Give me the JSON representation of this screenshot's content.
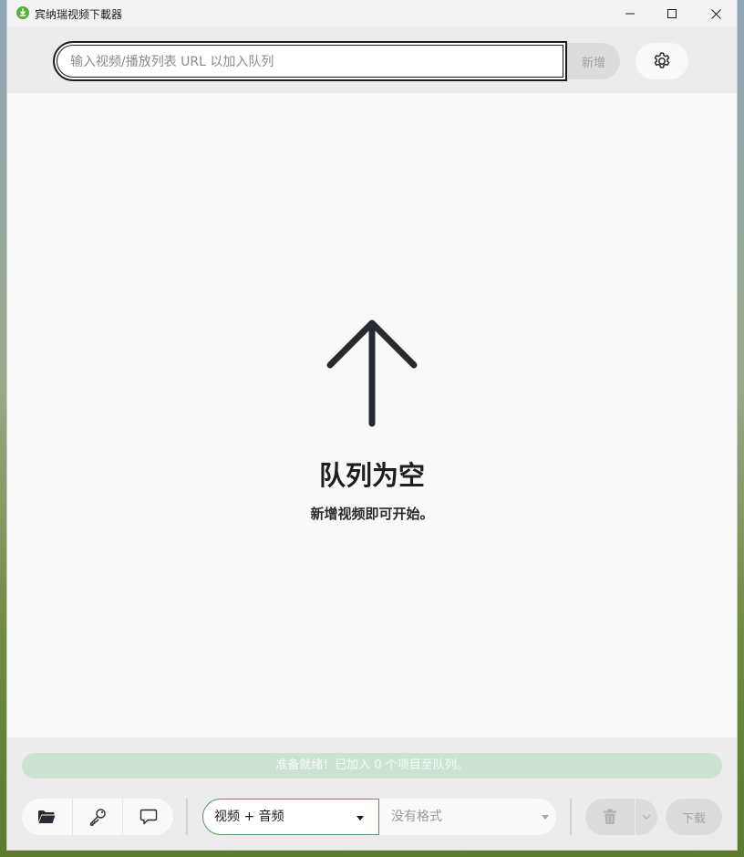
{
  "window": {
    "title": "宾纳瑞视频下載器",
    "controls": {
      "minimize": "minimize-icon",
      "maximize": "maximize-icon",
      "close": "close-icon"
    }
  },
  "toolbar": {
    "url_placeholder": "输入视频/播放列表 URL 以加入队列",
    "add_label": "新增",
    "settings_icon": "gear-icon"
  },
  "empty_state": {
    "icon": "arrow-up-icon",
    "title": "队列为空",
    "subtitle": "新增视频即可开始。"
  },
  "status": {
    "text": "准备就绪！已加入 0 个项目至队列。"
  },
  "bottom_bar": {
    "icons": [
      "folder-icon",
      "key-icon",
      "chat-icon"
    ],
    "format_selected": "视频 + 音频",
    "quality_placeholder": "没有格式",
    "download_label": "下载"
  },
  "colors": {
    "accent_green": "#4a9a5a",
    "status_bg": "#cce3d3",
    "app_icon": "#5cae3a"
  }
}
